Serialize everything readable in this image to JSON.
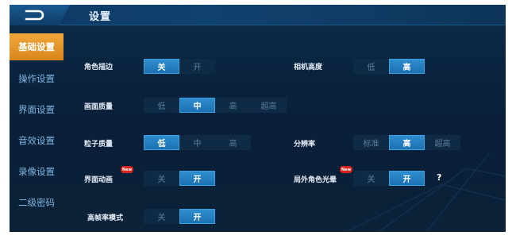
{
  "header": {
    "title": "设置"
  },
  "sidebar": {
    "items": [
      {
        "label": "基础设置",
        "active": true
      },
      {
        "label": "操作设置",
        "active": false
      },
      {
        "label": "界面设置",
        "active": false
      },
      {
        "label": "音效设置",
        "active": false
      },
      {
        "label": "录像设置",
        "active": false
      },
      {
        "label": "二级密码",
        "active": false
      }
    ]
  },
  "settings": {
    "character_outline": {
      "label": "角色描边",
      "options": [
        "关",
        "开"
      ],
      "selected": "关"
    },
    "camera_height": {
      "label": "相机高度",
      "options": [
        "低",
        "高"
      ],
      "selected": "高"
    },
    "graphics_quality": {
      "label": "画面质量",
      "options": [
        "低",
        "中",
        "高",
        "超高"
      ],
      "selected": "中"
    },
    "particle_quality": {
      "label": "粒子质量",
      "options": [
        "低",
        "中",
        "高"
      ],
      "selected": "低"
    },
    "resolution": {
      "label": "分辨率",
      "options": [
        "标准",
        "高",
        "超高"
      ],
      "selected": "高"
    },
    "ui_animation": {
      "label": "界面动画",
      "options": [
        "关",
        "开"
      ],
      "selected": "开",
      "badge": "New"
    },
    "outside_halo": {
      "label": "局外角色光晕",
      "options": [
        "关",
        "开"
      ],
      "selected": "开",
      "badge": "New",
      "help": "?"
    },
    "high_fps": {
      "label": "高帧率模式",
      "options": [
        "关",
        "开"
      ],
      "selected": "开"
    }
  },
  "colors": {
    "accent_orange": "#e39426",
    "selected_blue": "#2a86c8",
    "badge_red": "#d4241c",
    "background": "#0a1f38"
  }
}
